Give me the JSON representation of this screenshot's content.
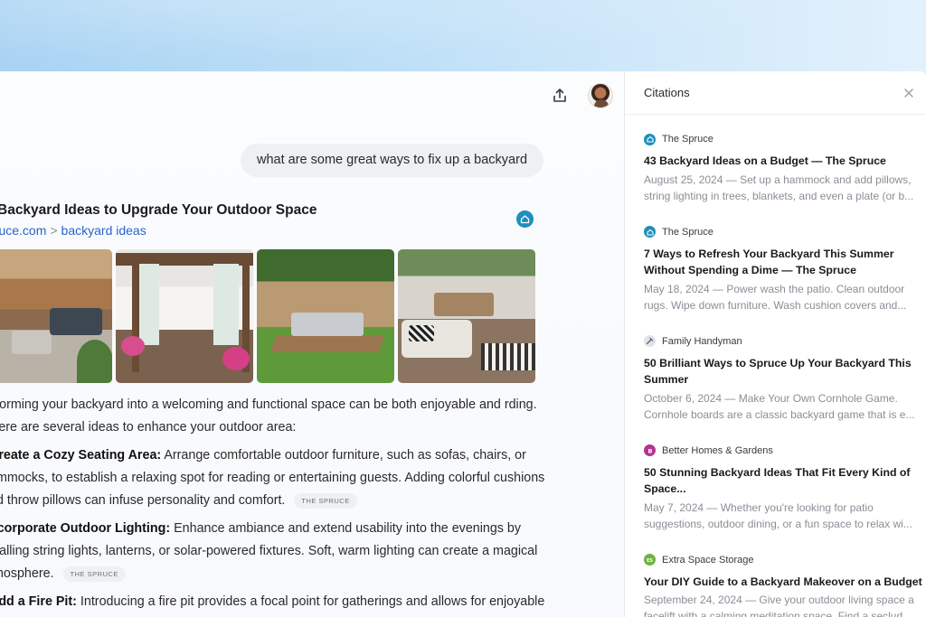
{
  "chat": {
    "user_query": "what are some great ways to fix up a backyard",
    "result": {
      "title": "Backyard Ideas to Upgrade Your Outdoor Space",
      "source_domain": "pruce.com",
      "source_separator": ">",
      "source_path": "backyard ideas",
      "icon": "home-icon"
    },
    "images": [
      {
        "name": "patio-fence-image"
      },
      {
        "name": "pergola-image"
      },
      {
        "name": "garden-lounge-image"
      },
      {
        "name": "pallet-lounge-image"
      }
    ],
    "intro": "sforming your backyard into a welcoming and functional space can be both enjoyable and rding. Here are several ideas to enhance your outdoor area:",
    "ideas": [
      {
        "title": "Create a Cozy Seating Area:",
        "text": "Arrange comfortable outdoor furniture, such as sofas, chairs, or ammocks, to establish a relaxing spot for reading or entertaining guests. Adding colorful cushions nd throw pillows can infuse personality and comfort.",
        "tag": "THE SPRUCE"
      },
      {
        "title": "ncorporate Outdoor Lighting:",
        "text": "Enhance ambiance and extend usability into the evenings by stalling string lights, lanterns, or solar-powered fixtures. Soft, warm lighting can create a magical tmosphere.",
        "tag": "THE SPRUCE"
      },
      {
        "title": "Add a Fire Pit:",
        "text": "Introducing a fire pit provides a focal point for gatherings and allows for enjoyable",
        "tag": ""
      }
    ]
  },
  "toolbar": {
    "share_icon": "share-icon",
    "avatar_icon": "user-avatar"
  },
  "citations": {
    "title": "Citations",
    "close_icon": "close-icon",
    "items": [
      {
        "source": "The Spruce",
        "favicon_color": "#1d8fbd",
        "headline": "43 Backyard Ideas on a Budget — The Spruce",
        "snippet": "August 25, 2024 — Set up a hammock and add pillows, string lighting in trees, blankets, and even a plate (or b..."
      },
      {
        "source": "The Spruce",
        "favicon_color": "#1d8fbd",
        "headline": "7 Ways to Refresh Your Backyard This Summer Without Spending a Dime — The Spruce",
        "snippet": "May 18, 2024 — Power wash the patio. Clean outdoor rugs. Wipe down furniture. Wash cushion covers and..."
      },
      {
        "source": "Family Handyman",
        "favicon_color": "#7a8a99",
        "headline": "50 Brilliant Ways to Spruce Up Your Backyard This Summer",
        "snippet": "October 6, 2024 — Make Your Own Cornhole Game. Cornhole boards are a classic backyard game that is e..."
      },
      {
        "source": "Better Homes & Gardens",
        "favicon_color": "#b2348f",
        "headline": "50 Stunning Backyard Ideas That Fit Every Kind of Space...",
        "snippet": "May 7, 2024 — Whether you're looking for patio suggestions, outdoor dining, or a fun space to relax wi..."
      },
      {
        "source": "Extra Space Storage",
        "favicon_color": "#6db33f",
        "headline": "Your DIY Guide to a Backyard Makeover on a Budget",
        "snippet": "September 24, 2024 — Give your outdoor living space a facelift with a calming meditation space. Find a seclud..."
      }
    ]
  }
}
